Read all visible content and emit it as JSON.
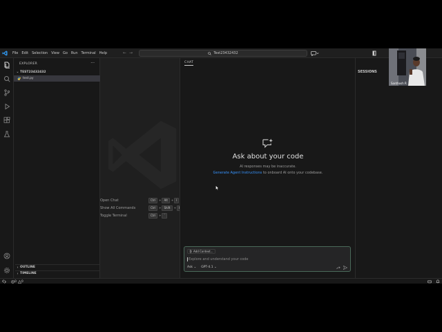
{
  "menu": [
    "File",
    "Edit",
    "Selection",
    "View",
    "Go",
    "Run",
    "Terminal",
    "Help"
  ],
  "search": {
    "title": "Test23432432"
  },
  "explorer": {
    "header": "EXPLORER",
    "more": "···",
    "folder": "TEST23432432",
    "file": "test.py",
    "outline": "OUTLINE",
    "timeline": "TIMELINE"
  },
  "editor": {
    "shortcuts": [
      {
        "label": "Open Chat",
        "keys": [
          "Ctrl",
          "Alt",
          "I"
        ]
      },
      {
        "label": "Show All Commands",
        "keys": [
          "Ctrl",
          "Shift",
          "P"
        ]
      },
      {
        "label": "Toggle Terminal",
        "keys": [
          "Ctrl",
          "`"
        ]
      }
    ]
  },
  "chat": {
    "header": "CHAT",
    "title": "Ask about your code",
    "subtitle": "AI responses may be inaccurate.",
    "link": "Generate Agent Instructions",
    "link_suffix": " to onboard AI onto your codebase.",
    "add_context": "Add Context...",
    "placeholder": "Explore and understand your code",
    "mode": "Ask ⌄",
    "model": "GPT-4.1 ⌄"
  },
  "sessions": {
    "header": "SESSIONS"
  },
  "status": {
    "errors": "0",
    "warnings": "0"
  },
  "webcam": {
    "name": "Santhosh R"
  },
  "colors": {
    "accent": "#3794ff",
    "background": "#181818",
    "editor": "#1f1f1f"
  }
}
